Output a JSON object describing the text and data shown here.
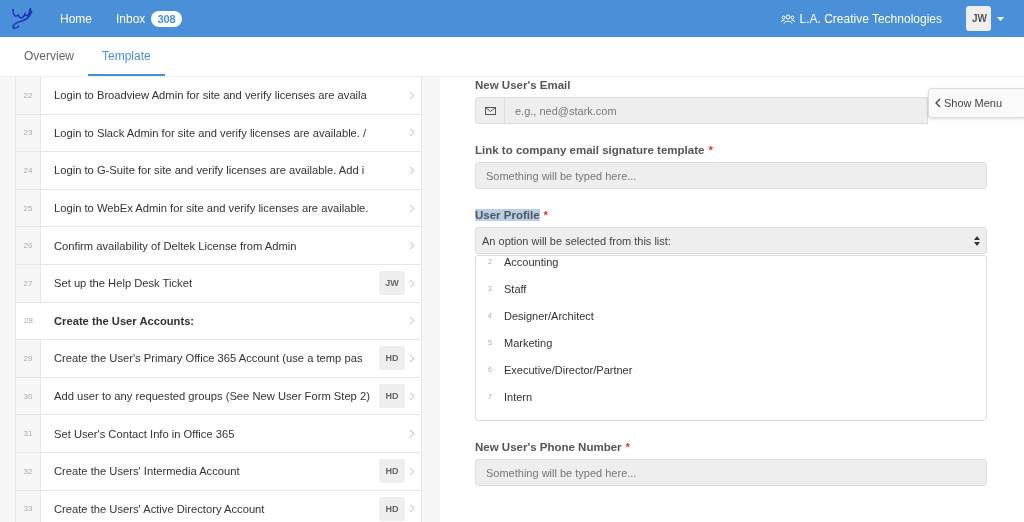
{
  "header": {
    "nav": [
      {
        "label": "Home"
      },
      {
        "label": "Inbox",
        "count": "308"
      }
    ],
    "organization": "L.A. Creative Technologies",
    "user_initials": "JW"
  },
  "tabs": [
    {
      "label": "Overview",
      "selected": false
    },
    {
      "label": "Template",
      "selected": true
    }
  ],
  "steps": [
    {
      "number": "22",
      "text": "Login to Broadview Admin for site and verify licenses are availa",
      "kind": "task"
    },
    {
      "number": "23",
      "text": "Login to Slack Admin for site and verify licenses are available. /",
      "kind": "task"
    },
    {
      "number": "24",
      "text": "Login to G-Suite for site and verify licenses are available. Add i",
      "kind": "task"
    },
    {
      "number": "25",
      "text": "Login to WebEx Admin for site and verify licenses are available.",
      "kind": "task"
    },
    {
      "number": "26",
      "text": "Confirm availability of Deltek License from Admin",
      "kind": "task"
    },
    {
      "number": "27",
      "text": "Set up the Help Desk Ticket",
      "kind": "task",
      "assignee": "JW"
    },
    {
      "number": "28",
      "text": "Create the User Accounts:",
      "kind": "heading"
    },
    {
      "number": "29",
      "text": "Create the User's Primary Office 365 Account (use a temp pas",
      "kind": "task",
      "assignee": "HD"
    },
    {
      "number": "30",
      "text": "Add user to any requested groups (See New User Form Step 2)",
      "kind": "task",
      "assignee": "HD"
    },
    {
      "number": "31",
      "text": "Set User's Contact Info in Office 365",
      "kind": "task"
    },
    {
      "number": "32",
      "text": "Create the Users' Intermedia Account",
      "kind": "task",
      "assignee": "HD"
    },
    {
      "number": "33",
      "text": "Create the Users' Active Directory Account",
      "kind": "task",
      "assignee": "HD"
    }
  ],
  "form": {
    "show_menu": "Show Menu",
    "fields": [
      {
        "kind": "email",
        "label": "New User's Email",
        "highlighted": false,
        "placeholder": "e.g., ned@stark.com"
      },
      {
        "kind": "text",
        "label": "Link to company email signature template",
        "required_mark": "*",
        "highlighted": false,
        "placeholder": "Something will be typed here..."
      },
      {
        "kind": "select",
        "label": "User Profile",
        "required_mark": "*",
        "highlighted": true,
        "placeholder": "An option will be selected from this list:",
        "options": [
          {
            "number": "2",
            "label": "Accounting"
          },
          {
            "number": "3",
            "label": "Staff"
          },
          {
            "number": "4",
            "label": "Designer/Architect"
          },
          {
            "number": "5",
            "label": "Marketing"
          },
          {
            "number": "6",
            "label": "Executive/Director/Partner"
          },
          {
            "number": "7",
            "label": "Intern"
          }
        ]
      },
      {
        "kind": "text",
        "label": "New User's Phone Number",
        "required_mark": "*",
        "highlighted": false,
        "placeholder": "Something will be typed here..."
      }
    ]
  }
}
